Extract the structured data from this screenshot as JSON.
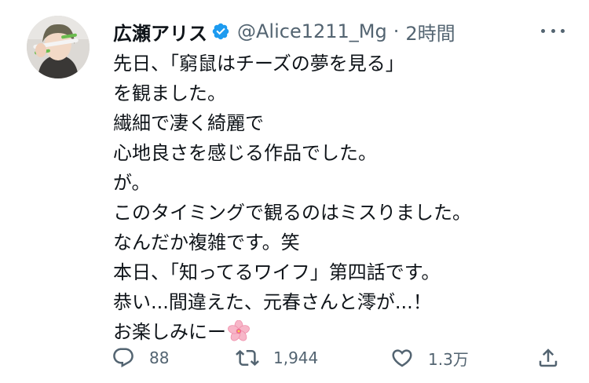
{
  "tweet": {
    "author": {
      "display_name": "広瀬アリス",
      "verified_icon": "verified-badge-icon",
      "handle": "@Alice1211_Mg",
      "separator": "·",
      "time": "2時間"
    },
    "body_lines": [
      "先日、「窮鼠はチーズの夢を見る」",
      "を観ました。",
      "繊細で凄く綺麗で",
      "心地良さを感じる作品でした。",
      "が。",
      "このタイミングで観るのはミスりました。",
      "なんだか複雑です。笑",
      "本日、「知ってるワイフ」第四話です。",
      "恭い...間違えた、元春さんと澪が...！",
      "お楽しみにー"
    ],
    "emoji": "cherry-blossom-icon",
    "actions": {
      "reply_count": "88",
      "retweet_count": "1,944",
      "like_count": "1.3万"
    },
    "colors": {
      "text": "#0f1419",
      "secondary": "#536471",
      "verified": "#1d9bf0"
    }
  }
}
